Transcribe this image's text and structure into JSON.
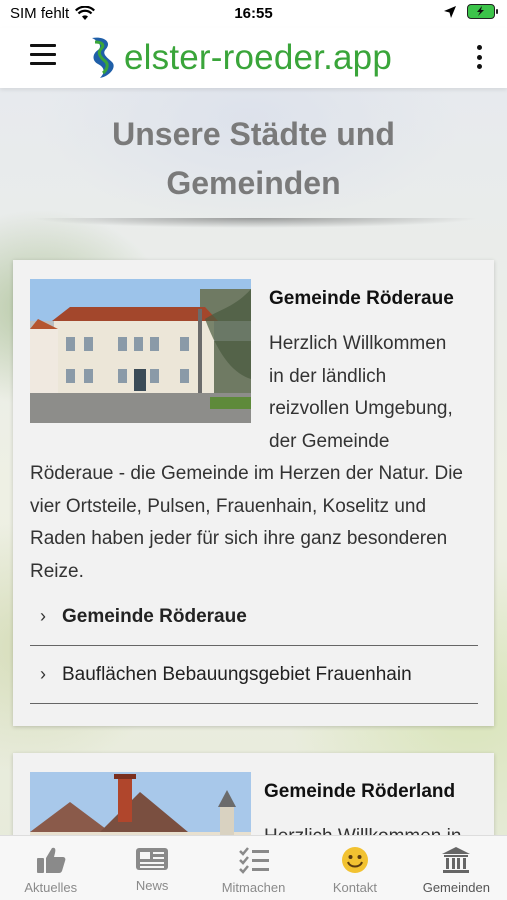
{
  "status_bar": {
    "carrier": "SIM fehlt",
    "time": "16:55"
  },
  "app": {
    "title": "elster-roeder.app"
  },
  "page": {
    "title_line1": "Unsere Städte und",
    "title_line2": "Gemeinden"
  },
  "cards": [
    {
      "title": "Gemeinde Röderaue",
      "text_lines_beside": [
        "Herzlich Willkommen",
        "in der ländlich",
        "reizvollen Umgebung,",
        "der Gemeinde"
      ],
      "text_lines_full": [
        "Röderaue - die Gemeinde im Herzen der Natur. Die",
        "vier Ortsteile, Pulsen, Frauenhain, Koselitz und",
        "Raden haben jeder für sich ihre ganz besonderen",
        "Reize."
      ],
      "links": [
        "Gemeinde Röderaue",
        "Bauflächen Bebauungsgebiet Frauenhain"
      ]
    },
    {
      "title": "Gemeinde Röderland",
      "text_lines_beside": [
        "Herzlich Willkommen in"
      ]
    }
  ],
  "tabs": [
    {
      "label": "Aktuelles",
      "icon": "thumbs-up-icon"
    },
    {
      "label": "News",
      "icon": "newspaper-icon"
    },
    {
      "label": "Mitmachen",
      "icon": "checklist-icon"
    },
    {
      "label": "Kontakt",
      "icon": "smiley-icon"
    },
    {
      "label": "Gemeinden",
      "icon": "townhall-icon"
    }
  ],
  "colors": {
    "brand_green": "#3aa53a",
    "brand_blue": "#1f5fa8",
    "smiley_yellow": "#f2c231",
    "battery_green": "#3cc44a"
  }
}
